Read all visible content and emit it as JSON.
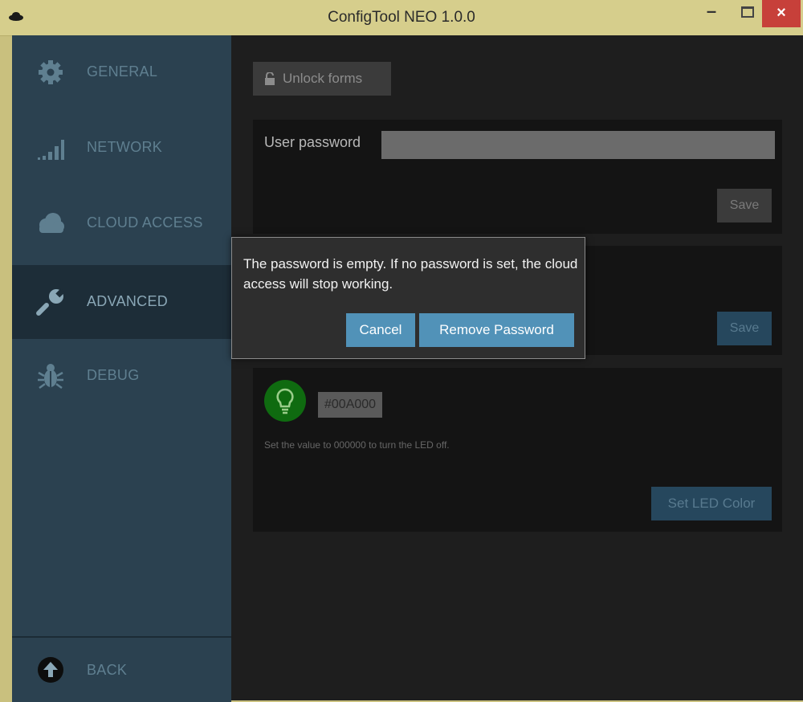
{
  "window": {
    "title": "ConfigTool NEO 1.0.0",
    "minimize_label": "–",
    "close_label": "×"
  },
  "sidebar": {
    "items": [
      {
        "label": "GENERAL",
        "icon": "gear-icon",
        "active": false
      },
      {
        "label": "NETWORK",
        "icon": "signal-bars-icon",
        "active": false
      },
      {
        "label": "CLOUD ACCESS",
        "icon": "cloud-icon",
        "active": false
      },
      {
        "label": "ADVANCED",
        "icon": "wrench-icon",
        "active": true
      },
      {
        "label": "DEBUG",
        "icon": "bug-icon",
        "active": false
      }
    ],
    "back": {
      "label": "BACK",
      "icon": "arrow-up-circle-icon"
    }
  },
  "main": {
    "unlock_label": "Unlock forms",
    "password_panel": {
      "label": "User password",
      "value": "",
      "save_label": "Save"
    },
    "second_panel": {
      "save_label": "Save"
    },
    "led_panel": {
      "color_value": "#00A000",
      "note": "Set the value to 000000 to turn the LED off.",
      "button_label": "Set LED Color"
    }
  },
  "dialog": {
    "message": "The password is empty. If no password is set, the cloud access will stop working.",
    "cancel_label": "Cancel",
    "confirm_label": "Remove Password"
  },
  "colors": {
    "sidebar_bg": "#2b4150",
    "sidebar_active": "#1d2d38",
    "accent_button": "#5192b8",
    "led_color": "#00A000"
  }
}
